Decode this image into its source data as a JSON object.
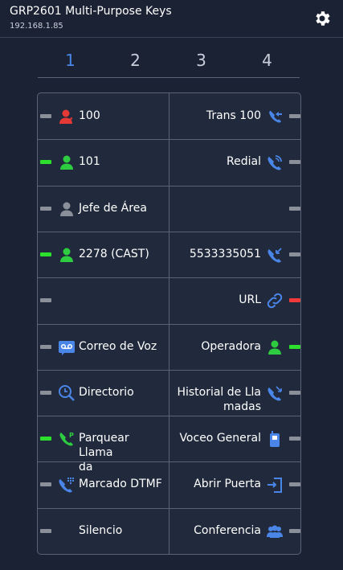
{
  "header": {
    "title": "GRP2601 Multi-Purpose Keys",
    "ip": "192.168.1.85"
  },
  "tabs": [
    "1",
    "2",
    "3",
    "4"
  ],
  "keys": {
    "left": [
      {
        "label": "100",
        "icon": "contact-red-icon",
        "led": "gray"
      },
      {
        "label": "101",
        "icon": "contact-green-icon",
        "led": "green"
      },
      {
        "label": "Jefe de Área",
        "icon": "contact-gray-icon",
        "led": "gray"
      },
      {
        "label": "2278 (CAST)",
        "icon": "contact-green-icon",
        "led": "green"
      },
      {
        "label": "",
        "icon": "",
        "led": "gray"
      },
      {
        "label": "Correo de Voz",
        "icon": "voicemail-icon",
        "led": "gray"
      },
      {
        "label": "Directorio",
        "icon": "directory-icon",
        "led": "gray"
      },
      {
        "label": "Parquear Llama\nda",
        "icon": "park-call-icon",
        "led": "green"
      },
      {
        "label": "Marcado DTMF",
        "icon": "dtmf-icon",
        "led": "gray"
      },
      {
        "label": "Silencio",
        "icon": "",
        "led": "gray"
      }
    ],
    "right": [
      {
        "label": "Trans 100",
        "icon": "transfer-icon",
        "led": "gray"
      },
      {
        "label": "Redial",
        "icon": "redial-icon",
        "led": "gray"
      },
      {
        "label": "",
        "icon": "",
        "led": "gray"
      },
      {
        "label": "5533335051",
        "icon": "speed-dial-icon",
        "led": "gray"
      },
      {
        "label": "URL",
        "icon": "link-icon",
        "led": "red"
      },
      {
        "label": "Operadora",
        "icon": "operator-icon",
        "led": "green"
      },
      {
        "label": "Historial de Lla\nmadas",
        "icon": "call-history-icon",
        "led": "gray"
      },
      {
        "label": "Voceo General",
        "icon": "intercom-icon",
        "led": "gray"
      },
      {
        "label": "Abrir Puerta",
        "icon": "door-open-icon",
        "led": "gray"
      },
      {
        "label": "Conferencia",
        "icon": "conference-icon",
        "led": "gray"
      }
    ]
  },
  "colors": {
    "background": "#1b2233",
    "accent": "#4a86e8",
    "led_green": "#2ee02e",
    "led_red": "#f03a3a",
    "led_off": "#8a8f99"
  }
}
